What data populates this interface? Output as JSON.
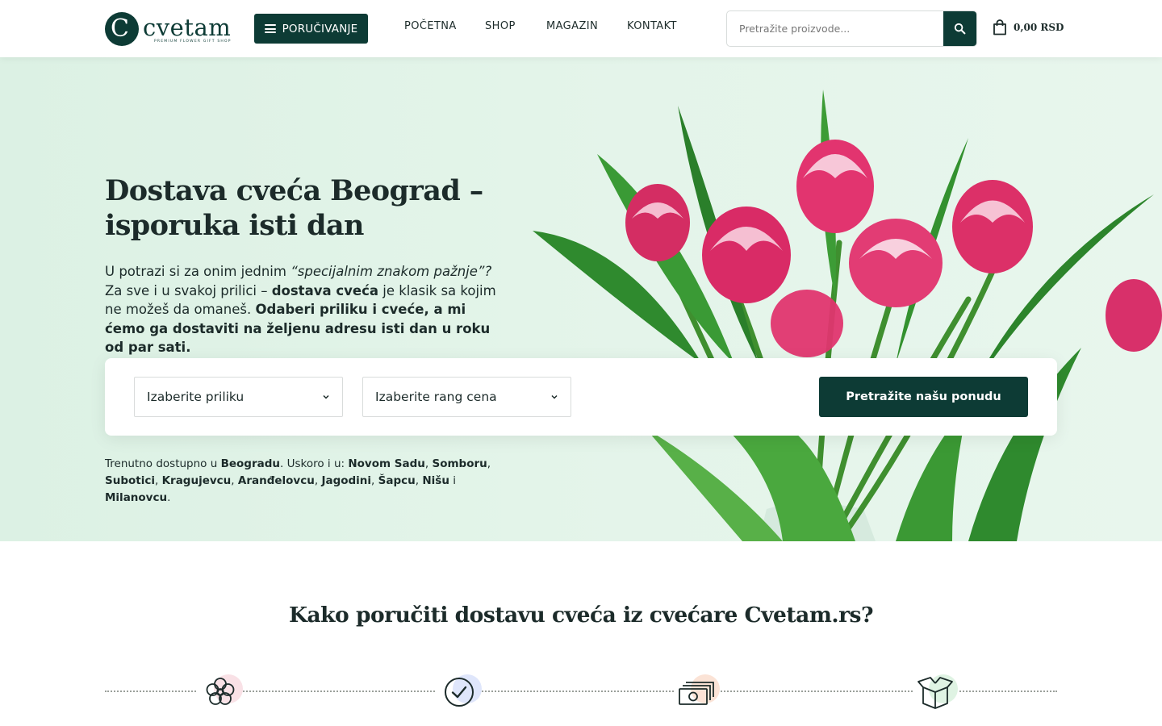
{
  "header": {
    "logo": {
      "name": "cvetam",
      "tagline": "PREMIUM FLOWER GIFT SHOP"
    },
    "order_button": "PORUČIVANJE",
    "nav": [
      "POČETNA",
      "SHOP",
      "MAGAZIN",
      "KONTAKT"
    ],
    "search": {
      "placeholder": "Pretražite proizvode..."
    },
    "cart": {
      "amount": "0,00 RSD"
    }
  },
  "hero": {
    "title_line1": "Dostava cveća Beograd –",
    "title_line2": "isporuka isti dan",
    "text": {
      "p1": "U potrazi si za onim jednim ",
      "p2_em": "“specijalnim znakom pažnje”?",
      "p3": " Za sve i u svakoj prilici – ",
      "p4_b": "dostava cveća",
      "p5": " je klasik sa kojim ne možeš da omaneš. ",
      "p6_b": "Odaberi priliku i cveće, a mi ćemo ga dostaviti na željenu adresu isti dan u roku od par sati."
    },
    "filters": {
      "occasion": "Izaberite priliku",
      "price_range": "Izaberite rang cena",
      "submit": "Pretražite našu ponudu"
    },
    "availability": {
      "a1": "Trenutno dostupno u ",
      "a2_b": "Beogradu",
      "a3": ". Uskoro i u: ",
      "a4_b": "Novom Sadu",
      "a5": ", ",
      "a6_b": "Somboru",
      "a7": ", ",
      "a8_b": "Subotici",
      "a9": ", ",
      "a10_b": "Kragujevcu",
      "a11": ", ",
      "a12_b": "Aranđelovcu",
      "a13": ", ",
      "a14_b": "Jagodini",
      "a15": ", ",
      "a16_b": "Šapcu",
      "a17": ", ",
      "a18_b": "Nišu",
      "a19": " i ",
      "a20_b": "Milanovcu",
      "a21": "."
    }
  },
  "how_to_order": {
    "title": "Kako poručiti dostavu cveća iz cvećare Cvetam.rs?",
    "steps": [
      {
        "icon": "flower-icon",
        "halo": "#f9e1e6"
      },
      {
        "icon": "check-circle-icon",
        "halo": "#dfe6fb"
      },
      {
        "icon": "money-stack-icon",
        "halo": "#fbe3d6"
      },
      {
        "icon": "open-box-icon",
        "halo": "#dff3e3"
      }
    ]
  },
  "colors": {
    "brand": "#0d3b35",
    "hero_bg": "#e3f4e9",
    "tulip_pink": "#e2346f",
    "leaf_green": "#2f8a2e"
  }
}
